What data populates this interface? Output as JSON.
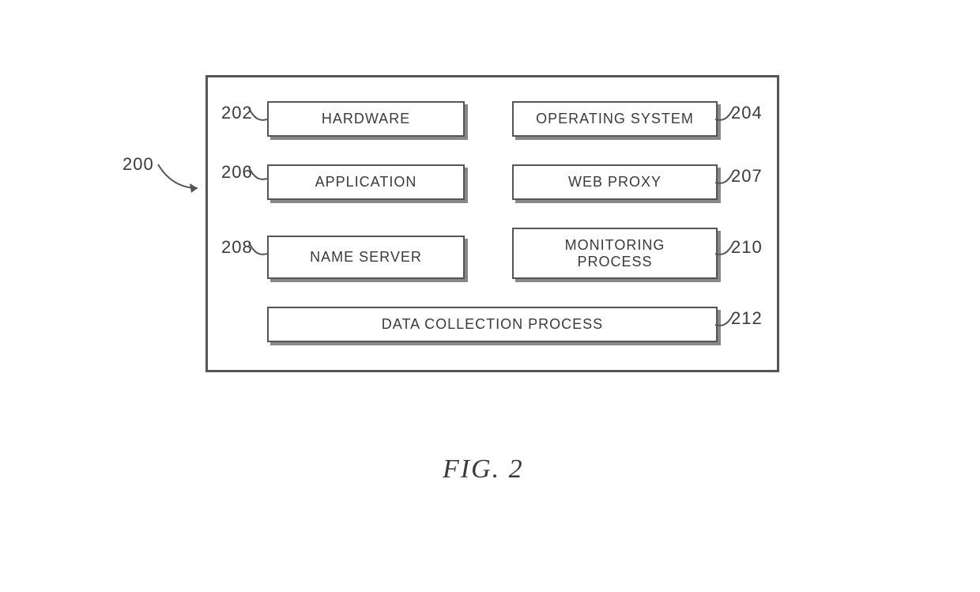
{
  "figure": {
    "caption": "FIG. 2",
    "container_ref": "200",
    "blocks": {
      "hardware": {
        "ref": "202",
        "label": "HARDWARE"
      },
      "os": {
        "ref": "204",
        "label": "OPERATING SYSTEM"
      },
      "application": {
        "ref": "206",
        "label": "APPLICATION"
      },
      "web_proxy": {
        "ref": "207",
        "label": "WEB PROXY"
      },
      "name_server": {
        "ref": "208",
        "label": "NAME SERVER"
      },
      "monitoring": {
        "ref": "210",
        "label": "MONITORING\nPROCESS"
      },
      "data_coll": {
        "ref": "212",
        "label": "DATA COLLECTION PROCESS"
      }
    }
  }
}
